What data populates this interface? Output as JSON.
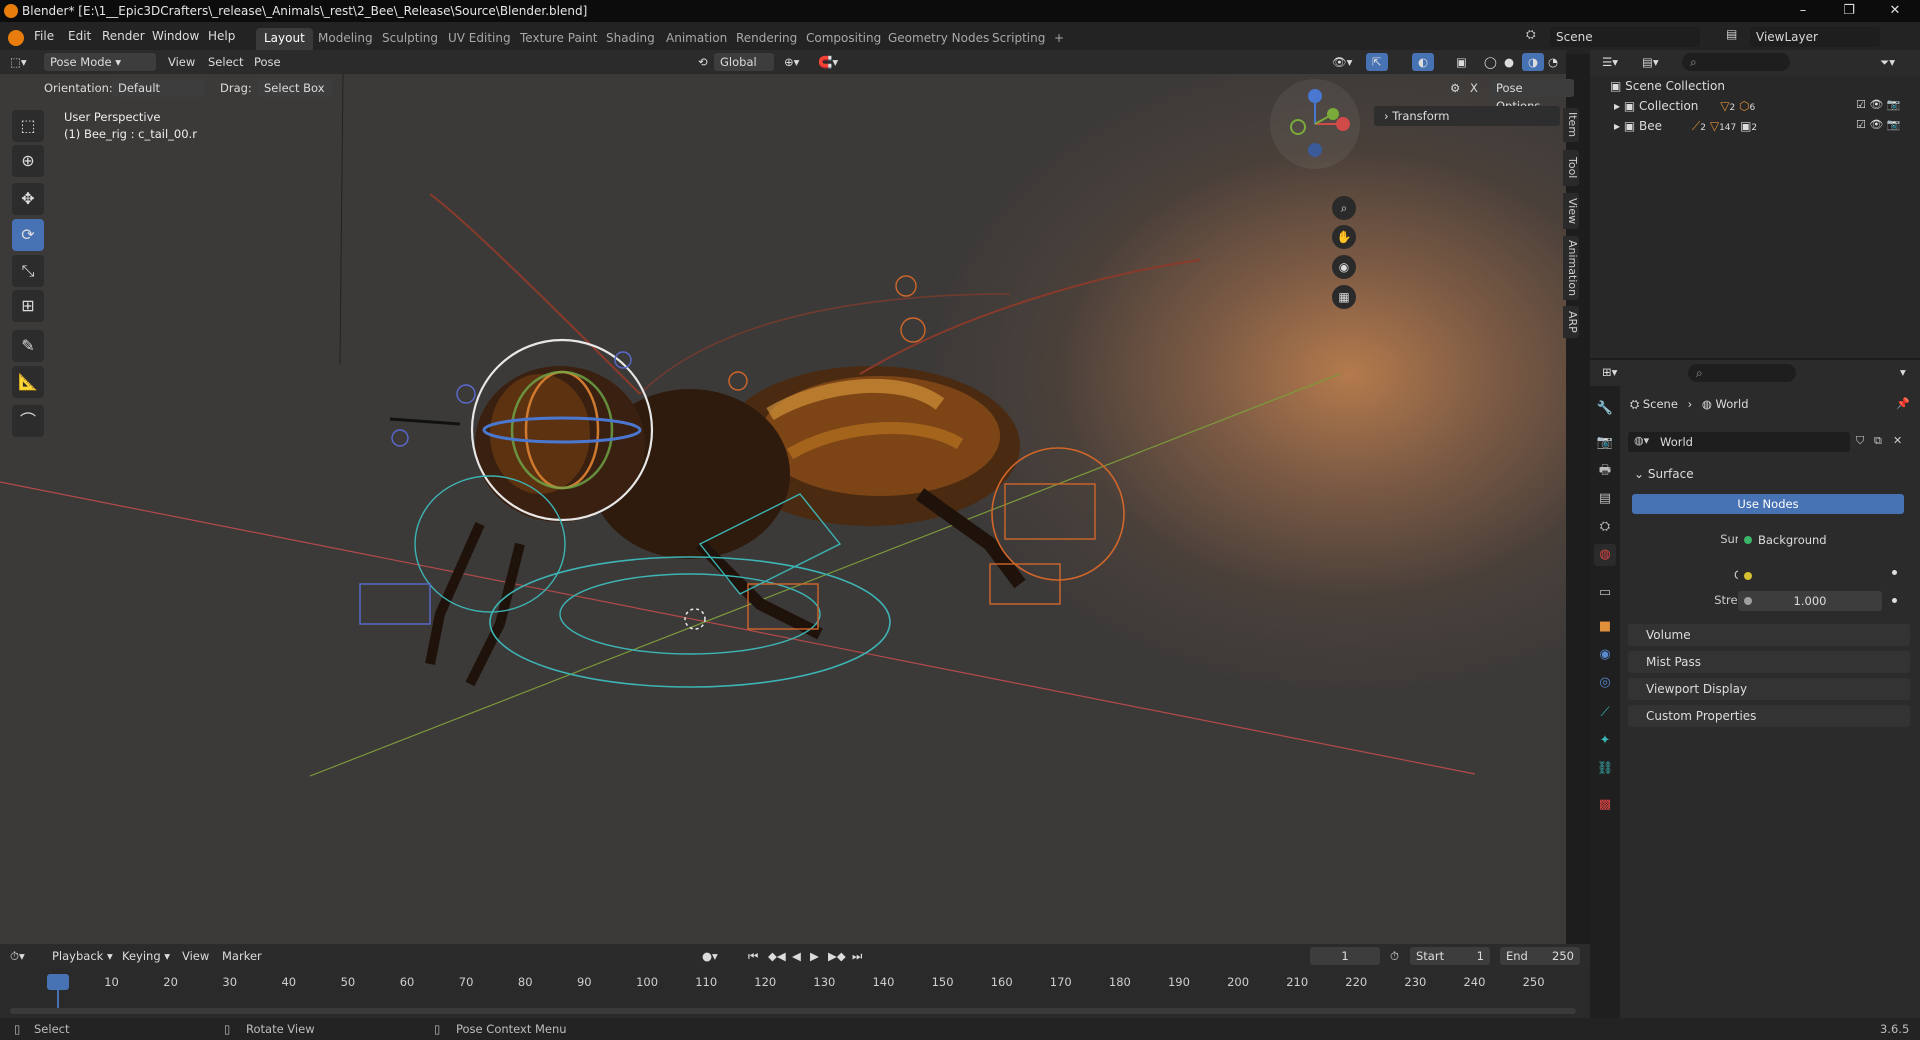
{
  "window": {
    "title": "Blender* [E:\\1__Epic3DCrafters\\_release\\_Animals\\_rest\\2_Bee\\_Release\\Source\\Blender.blend]"
  },
  "menu": [
    "File",
    "Edit",
    "Render",
    "Window",
    "Help"
  ],
  "workspaces": [
    "Layout",
    "Modeling",
    "Sculpting",
    "UV Editing",
    "Texture Paint",
    "Shading",
    "Animation",
    "Rendering",
    "Compositing",
    "Geometry Nodes",
    "Scripting"
  ],
  "active_workspace": "Layout",
  "scene_name": "Scene",
  "viewlayer_name": "ViewLayer",
  "viewport_header": {
    "mode": "Pose Mode",
    "view": "View",
    "select": "Select",
    "pose": "Pose",
    "transform_orientation": "Global"
  },
  "tool_settings": {
    "orientation_label": "Orientation:",
    "orientation_value": "Default",
    "drag_label": "Drag:",
    "drag_value": "Select Box",
    "pose_options": "Pose Options"
  },
  "viewport": {
    "perspective": "User Perspective",
    "active_object": "(1) Bee_rig : c_tail_00.r",
    "n_panel_tab": "Transform",
    "gizmo_axes": [
      "Z",
      "Y",
      "X"
    ]
  },
  "side_tabs": [
    "Item",
    "Tool",
    "View",
    "Animation",
    "ARP"
  ],
  "outliner": {
    "root": "Scene Collection",
    "items": [
      {
        "name": "Collection",
        "badge1": "2",
        "badge2": "6"
      },
      {
        "name": "Bee",
        "badge1": "2",
        "badge2": "147",
        "badge3": "2"
      }
    ]
  },
  "properties": {
    "breadcrumb_scene": "Scene",
    "breadcrumb_world": "World",
    "world_name": "World",
    "surface_panel": "Surface",
    "use_nodes": "Use Nodes",
    "surface_label": "Surface",
    "surface_value": "Background",
    "color_label": "Color",
    "strength_label": "Strength",
    "strength_value": "1.000",
    "panels": [
      "Volume",
      "Mist Pass",
      "Viewport Display",
      "Custom Properties"
    ]
  },
  "timeline": {
    "playback": "Playback",
    "keying": "Keying",
    "view": "View",
    "marker": "Marker",
    "current_frame": "1",
    "start_label": "Start",
    "start_value": "1",
    "end_label": "End",
    "end_value": "250",
    "ticks": [
      "1",
      "10",
      "20",
      "30",
      "40",
      "50",
      "60",
      "70",
      "80",
      "90",
      "100",
      "110",
      "120",
      "130",
      "140",
      "150",
      "160",
      "170",
      "180",
      "190",
      "200",
      "210",
      "220",
      "230",
      "240",
      "250"
    ]
  },
  "statusbar": {
    "select": "Select",
    "rotate": "Rotate View",
    "context": "Pose Context Menu",
    "version": "3.6.5"
  }
}
